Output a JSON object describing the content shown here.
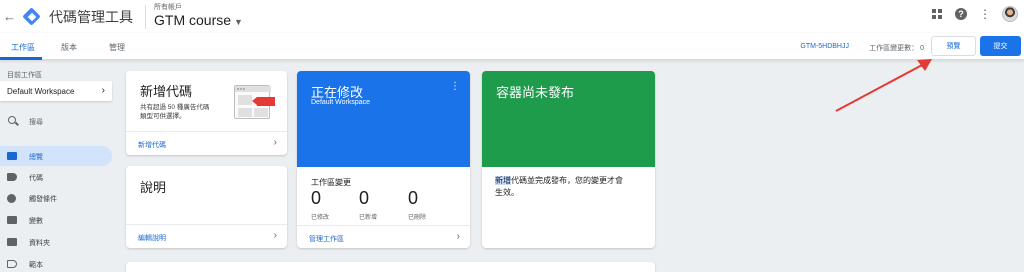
{
  "header": {
    "back_icon": "back-arrow-icon",
    "app_title": "代碼管理工具",
    "account_label": "所有帳戶",
    "container_name": "GTM course",
    "icons": [
      "apps-grid-icon",
      "help-icon",
      "more-vert-icon",
      "avatar"
    ]
  },
  "tabs": [
    {
      "label": "工作區",
      "active": true
    },
    {
      "label": "版本",
      "active": false
    },
    {
      "label": "管理",
      "active": false
    }
  ],
  "toolbar": {
    "container_id": "GTM-5HDBHJJ",
    "workspace_changes": "工作區變更數： 0",
    "preview_label": "預覽",
    "submit_label": "提交"
  },
  "sidebar": {
    "current_ws_label": "目前工作區",
    "workspace_name": "Default Workspace",
    "search_placeholder": "搜尋",
    "items": [
      {
        "label": "總覽",
        "icon": "overview-icon",
        "active": true
      },
      {
        "label": "代碼",
        "icon": "tag-icon",
        "active": false
      },
      {
        "label": "觸發條件",
        "icon": "trigger-icon",
        "active": false
      },
      {
        "label": "變數",
        "icon": "variable-icon",
        "active": false
      },
      {
        "label": "資料夾",
        "icon": "folder-icon",
        "active": false
      },
      {
        "label": "範本",
        "icon": "template-icon",
        "active": false
      }
    ]
  },
  "cards": {
    "new_tag": {
      "title": "新增代碼",
      "desc_line1": "共有超過 50 種廣告代碼",
      "desc_line2": "類型可供選擇。",
      "link": "新增代碼"
    },
    "description": {
      "title": "說明",
      "link": "編輯說明"
    },
    "editing": {
      "title": "正在修改",
      "subtitle": "Default Workspace",
      "changes_title": "工作區變更",
      "stats": [
        {
          "value": "0",
          "label": "已修改"
        },
        {
          "value": "0",
          "label": "已新增"
        },
        {
          "value": "0",
          "label": "已刪除"
        }
      ],
      "link": "管理工作區"
    },
    "unpublished": {
      "title": "容器尚未發布",
      "text_highlight": "新增",
      "text_line1_rest": "代碼並完成發布，您的變更才會",
      "text_line2": "生效。"
    }
  },
  "colors": {
    "accent_blue": "#1a73e8",
    "link_blue": "#1967d2",
    "card_green": "#1e9b4b",
    "arrow_red": "#e53935"
  }
}
